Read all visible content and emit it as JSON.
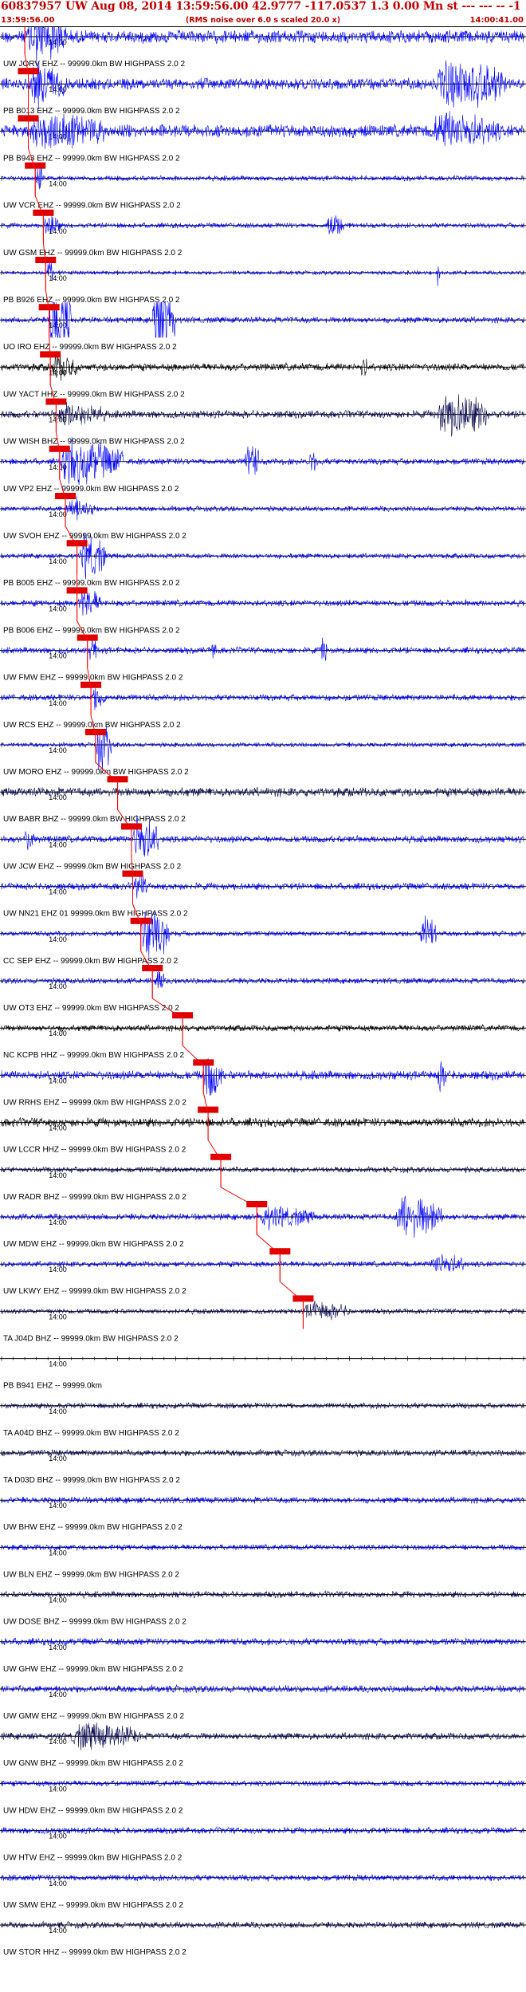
{
  "header": {
    "title": "60837957 UW Aug 08, 2014 13:59:56.00   42.9777 -117.0537  1.3 0.00 Mn st --- --- --  -1",
    "start_time": "13:59:56.00",
    "subtitle": "(RMS noise over 6.0 s scaled 20.0 x)",
    "end_time": "14:00:41.00"
  },
  "colors": {
    "title": "#c00000",
    "trace_main": "#0000ff",
    "trace_dark": "#0a0a50",
    "trace_black": "#000000",
    "pick": "#ff0000",
    "pick_box": "#e00000",
    "axis": "#000000"
  },
  "chart_data": {
    "type": "seismogram",
    "x_start": "13:59:56.00",
    "x_end": "14:00:41.00",
    "duration_s": 45,
    "tick_interval_s": 1,
    "center_tick_label": "14:00",
    "center_tick_s": 4,
    "rows": [
      {
        "label": "UW JORV EHZ -- 99999.0km BW  HIGHPASS  2.0  2",
        "pick_s": 2.0,
        "amp": 1.0,
        "events": [
          [
            2.2,
            5.6,
            1.0
          ],
          [
            0,
            1.5,
            0.18
          ]
        ],
        "color": "main"
      },
      {
        "label": "PB B013 EHZ -- 99999.0km BW  HIGHPASS  2.0  2",
        "pick_s": 2.3,
        "amp": 0.9,
        "events": [
          [
            2.4,
            5.5,
            0.8
          ],
          [
            37.5,
            43.5,
            0.9
          ]
        ],
        "color": "main"
      },
      {
        "label": "PB B943 EHZ -- 99999.0km BW  HIGHPASS  2.0  2",
        "pick_s": 2.3,
        "amp": 1.0,
        "events": [
          [
            2.3,
            9.0,
            0.7
          ],
          [
            37,
            43,
            0.7
          ]
        ],
        "color": "main"
      },
      {
        "label": "UW VCR EHZ -- 99999.0km BW  HIGHPASS  2.0  2",
        "pick_s": 2.9,
        "amp": 0.4,
        "events": [
          [
            3.0,
            3.6,
            0.6
          ]
        ],
        "color": "main"
      },
      {
        "label": "UW GSM EHZ -- 99999.0km BW  HIGHPASS  2.0  2",
        "pick_s": 3.6,
        "amp": 0.4,
        "events": [
          [
            3.7,
            5.0,
            0.45
          ],
          [
            28,
            29.5,
            0.5
          ]
        ],
        "color": "main"
      },
      {
        "label": "PB B926 EHZ -- 99999.0km BW  HIGHPASS  2.0  2",
        "pick_s": 3.8,
        "amp": 0.3,
        "events": [
          [
            3.9,
            4.4,
            0.55
          ],
          [
            37.5,
            37.8,
            0.7
          ]
        ],
        "color": "main"
      },
      {
        "label": "UO IRO EHZ -- 99999.0km BW  HIGHPASS  2.0  2",
        "pick_s": 4.1,
        "amp": 0.3,
        "events": [
          [
            4.1,
            6.0,
            1.0
          ],
          [
            13.0,
            15.0,
            1.0
          ]
        ],
        "color": "main",
        "clipped": true
      },
      {
        "label": "UW YACT HHZ -- 99999.0km BW  HIGHPASS  2.0  2",
        "pick_s": 4.2,
        "amp": 0.6,
        "events": [
          [
            4.3,
            6.5,
            0.5
          ],
          [
            31,
            31.5,
            0.5
          ]
        ],
        "color": "black"
      },
      {
        "label": "UW WISH BHZ -- 99999.0km BW  HIGHPASS  2.0  2",
        "pick_s": 4.7,
        "amp": 0.6,
        "events": [
          [
            4.8,
            9.0,
            0.45
          ],
          [
            37.5,
            42,
            0.8
          ]
        ],
        "color": "dark"
      },
      {
        "label": "UW VP2 EHZ -- 99999.0km BW  HIGHPASS  2.0  2",
        "pick_s": 5.0,
        "amp": 0.5,
        "events": [
          [
            5.0,
            10.5,
            0.8
          ],
          [
            21,
            22.2,
            0.75
          ],
          [
            26.5,
            27.3,
            0.45
          ]
        ],
        "color": "main"
      },
      {
        "label": "UW SVOH EHZ -- 99999.0km BW  HIGHPASS  2.0  2",
        "pick_s": 5.5,
        "amp": 0.4,
        "events": [
          [
            5.6,
            8.0,
            0.45
          ]
        ],
        "color": "main"
      },
      {
        "label": "PB B005 EHZ -- 99999.0km BW  HIGHPASS  2.0  2",
        "pick_s": 6.5,
        "amp": 0.4,
        "events": [
          [
            6.8,
            9.0,
            0.8
          ]
        ],
        "color": "main"
      },
      {
        "label": "PB B006 EHZ -- 99999.0km BW  HIGHPASS  2.0  2",
        "pick_s": 6.5,
        "amp": 0.5,
        "events": [
          [
            6.6,
            8.5,
            0.6
          ]
        ],
        "color": "main"
      },
      {
        "label": "UW FMW EHZ -- 99999.0km BW  HIGHPASS  2.0  2",
        "pick_s": 7.4,
        "amp": 0.5,
        "events": [
          [
            7.6,
            8.3,
            0.6
          ],
          [
            18,
            18.5,
            0.45
          ],
          [
            27.5,
            28.2,
            0.5
          ]
        ],
        "color": "main"
      },
      {
        "label": "UW RCS EHZ -- 99999.0km BW  HIGHPASS  2.0  2",
        "pick_s": 7.7,
        "amp": 0.5,
        "events": [
          [
            7.8,
            9.0,
            0.5
          ]
        ],
        "color": "main"
      },
      {
        "label": "UW MORO EHZ -- 99999.0km BW  HIGHPASS  2.0  2",
        "pick_s": 8.1,
        "amp": 0.35,
        "events": [
          [
            8.2,
            9.5,
            0.9
          ]
        ],
        "color": "main"
      },
      {
        "label": "UW BABR BHZ -- 99999.0km BW  HIGHPASS  2.0  2",
        "pick_s": 10.0,
        "amp": 0.7,
        "events": [],
        "color": "dark"
      },
      {
        "label": "UW JCW EHZ -- 99999.0km BW  HIGHPASS  2.0  2",
        "pick_s": 11.2,
        "amp": 0.55,
        "events": [
          [
            11.3,
            13.5,
            0.9
          ],
          [
            2,
            3,
            0.45
          ]
        ],
        "color": "main"
      },
      {
        "label": "UW NN21 EHZ 01 99999.0km BW  HIGHPASS  2.0  2",
        "pick_s": 11.3,
        "amp": 0.55,
        "events": [
          [
            11.4,
            12.5,
            0.5
          ]
        ],
        "color": "main"
      },
      {
        "label": "CC SEP EHZ -- 99999.0km BW  HIGHPASS  2.0  2",
        "pick_s": 12.0,
        "amp": 0.4,
        "events": [
          [
            12.0,
            14.5,
            0.9
          ],
          [
            36,
            37.5,
            0.7
          ]
        ],
        "color": "main"
      },
      {
        "label": "UW OT3 EHZ -- 99999.0km BW  HIGHPASS  2.0  2",
        "pick_s": 13.0,
        "amp": 0.45,
        "events": [
          [
            13.2,
            14.0,
            0.5
          ]
        ],
        "color": "main"
      },
      {
        "label": "NC KCPB HHZ -- 99999.0km BW  HIGHPASS  2.0  2",
        "pick_s": 15.6,
        "amp": 0.5,
        "events": [],
        "color": "black"
      },
      {
        "label": "UW RRHS EHZ -- 99999.0km BW  HIGHPASS  2.0  2",
        "pick_s": 17.4,
        "amp": 0.7,
        "events": [
          [
            17.5,
            19.0,
            0.9
          ],
          [
            37.5,
            38.5,
            0.55
          ]
        ],
        "color": "main"
      },
      {
        "label": "UW LCCR HHZ -- 99999.0km BW  HIGHPASS  2.0  2",
        "pick_s": 17.8,
        "amp": 0.7,
        "events": [],
        "color": "black"
      },
      {
        "label": "UW RADR BHZ -- 99999.0km BW  HIGHPASS  2.0  2",
        "pick_s": 18.9,
        "amp": 0.45,
        "events": [],
        "color": "dark"
      },
      {
        "label": "UW MDW EHZ -- 99999.0km BW  HIGHPASS  2.0  2",
        "pick_s": 22.0,
        "amp": 0.5,
        "events": [
          [
            22.0,
            27.0,
            0.4
          ],
          [
            34,
            38,
            0.8
          ]
        ],
        "color": "main"
      },
      {
        "label": "UW LKWY EHZ -- 99999.0km BW  HIGHPASS  2.0  2",
        "pick_s": 24.0,
        "amp": 0.45,
        "events": [
          [
            37,
            40,
            0.4
          ]
        ],
        "color": "main"
      },
      {
        "label": "TA J04D BHZ -- 99999.0km BW  HIGHPASS  2.0  2",
        "pick_s": 26.0,
        "amp": 0.4,
        "events": [
          [
            26.0,
            30,
            0.35
          ]
        ],
        "color": "dark"
      },
      {
        "label": "PB B941 EHZ -- 99999.0km",
        "pick_s": null,
        "amp": 0.0,
        "events": [],
        "color": "main",
        "flat": true
      },
      {
        "label": "TA A04D BHZ -- 99999.0km BW  HIGHPASS  2.0  2",
        "pick_s": null,
        "amp": 0.45,
        "events": [],
        "color": "dark"
      },
      {
        "label": "TA D03D BHZ -- 99999.0km BW  HIGHPASS  2.0  2",
        "pick_s": null,
        "amp": 0.5,
        "events": [],
        "color": "dark"
      },
      {
        "label": "UW BHW EHZ -- 99999.0km BW  HIGHPASS  2.0  2",
        "pick_s": null,
        "amp": 0.5,
        "events": [],
        "color": "main"
      },
      {
        "label": "UW BLN EHZ -- 99999.0km BW  HIGHPASS  2.0  2",
        "pick_s": null,
        "amp": 0.45,
        "events": [],
        "color": "main"
      },
      {
        "label": "UW DOSE BHZ -- 99999.0km BW  HIGHPASS  2.0  2",
        "pick_s": null,
        "amp": 0.5,
        "events": [],
        "color": "dark"
      },
      {
        "label": "UW GHW EHZ -- 99999.0km BW  HIGHPASS  2.0  2",
        "pick_s": null,
        "amp": 0.55,
        "events": [],
        "color": "main"
      },
      {
        "label": "UW GMW EHZ -- 99999.0km BW  HIGHPASS  2.0  2",
        "pick_s": null,
        "amp": 0.55,
        "events": [],
        "color": "main"
      },
      {
        "label": "UW GNW BHZ -- 99999.0km BW  HIGHPASS  2.0  2",
        "pick_s": null,
        "amp": 0.55,
        "events": [
          [
            6,
            12,
            0.5
          ]
        ],
        "color": "dark"
      },
      {
        "label": "UW HDW EHZ -- 99999.0km BW  HIGHPASS  2.0  2",
        "pick_s": null,
        "amp": 0.45,
        "events": [],
        "color": "main"
      },
      {
        "label": "UW HTW EHZ -- 99999.0km BW  HIGHPASS  2.0  2",
        "pick_s": null,
        "amp": 0.5,
        "events": [],
        "color": "main"
      },
      {
        "label": "UW SMW EHZ -- 99999.0km BW  HIGHPASS  2.0  2",
        "pick_s": null,
        "amp": 0.5,
        "events": [],
        "color": "main"
      },
      {
        "label": "UW STOR HHZ -- 99999.0km BW  HIGHPASS  2.0  2",
        "pick_s": null,
        "amp": 0.5,
        "events": [],
        "color": "dark"
      }
    ]
  }
}
